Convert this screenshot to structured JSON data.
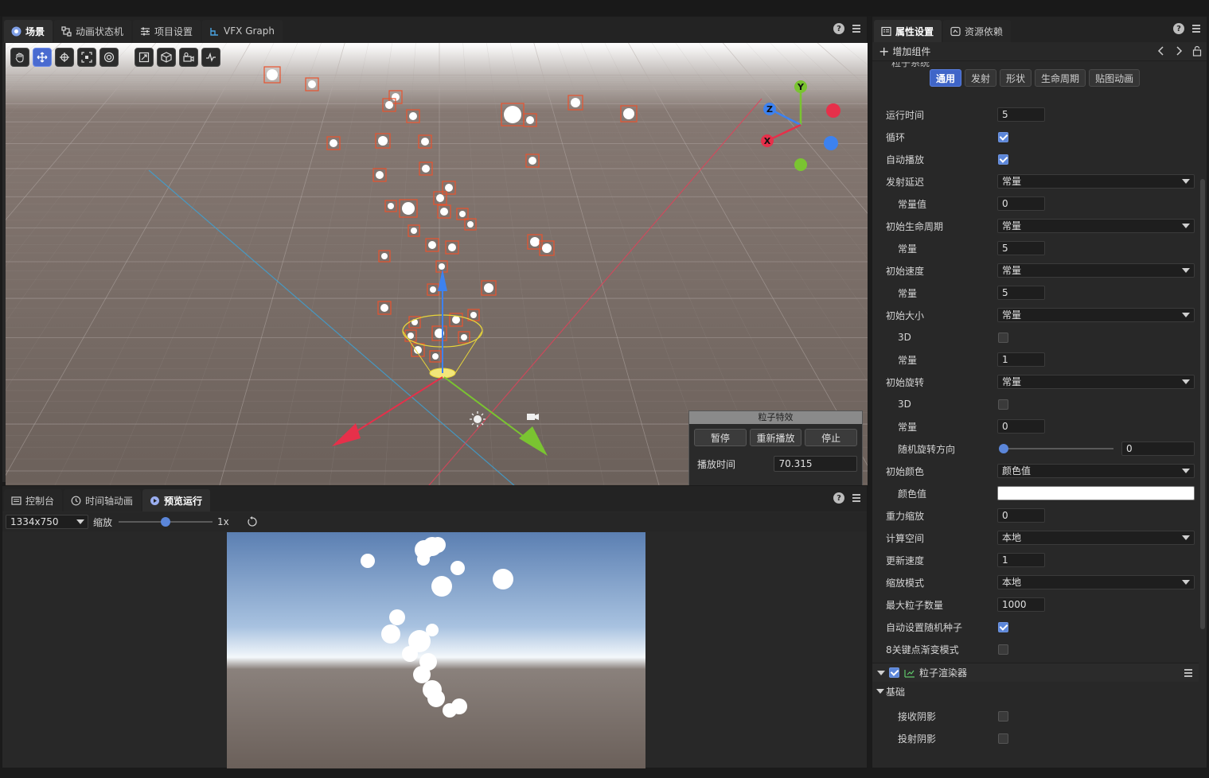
{
  "scene_panel": {
    "tabs": [
      {
        "label": "场景"
      },
      {
        "label": "动画状态机"
      },
      {
        "label": "项目设置"
      },
      {
        "label": "VFX Graph"
      }
    ],
    "help": "?"
  },
  "gizmo": {
    "x": "X",
    "y": "Y",
    "z": "Z"
  },
  "particle_fx": {
    "title": "粒子特效",
    "pause_label": "暂停",
    "replay_label": "重新播放",
    "stop_label": "停止",
    "play_time_label": "播放时间",
    "play_time_value": "70.315"
  },
  "bottom_panel": {
    "tabs": [
      {
        "label": "控制台"
      },
      {
        "label": "时间轴动画"
      },
      {
        "label": "预览运行"
      }
    ],
    "help": "?",
    "resolution": "1334x750",
    "zoom_label": "缩放",
    "zoom_value": "1x",
    "zoom_fraction": 0.5
  },
  "inspector": {
    "tabs": [
      {
        "label": "属性设置"
      },
      {
        "label": "资源依赖"
      }
    ],
    "help": "?",
    "add_component": "增加组件",
    "cut_label": "粒子系统",
    "subtabs": [
      "通用",
      "发射",
      "形状",
      "生命周期",
      "贴图动画"
    ],
    "props": {
      "duration": {
        "label": "运行时间",
        "value": "5"
      },
      "loop": {
        "label": "循环"
      },
      "auto_play": {
        "label": "自动播放"
      },
      "start_delay": {
        "label": "发射延迟",
        "mode": "常量"
      },
      "start_delay_const": {
        "label": "常量值",
        "value": "0"
      },
      "start_lifetime": {
        "label": "初始生命周期",
        "mode": "常量"
      },
      "start_lifetime_const": {
        "label": "常量",
        "value": "5"
      },
      "start_speed": {
        "label": "初始速度",
        "mode": "常量"
      },
      "start_speed_const": {
        "label": "常量",
        "value": "5"
      },
      "start_size": {
        "label": "初始大小",
        "mode": "常量"
      },
      "start_size_3d": {
        "label": "3D"
      },
      "start_size_const": {
        "label": "常量",
        "value": "1"
      },
      "start_rotation": {
        "label": "初始旋转",
        "mode": "常量"
      },
      "start_rotation_3d": {
        "label": "3D"
      },
      "start_rotation_const": {
        "label": "常量",
        "value": "0"
      },
      "random_rotation": {
        "label": "随机旋转方向",
        "value": "0"
      },
      "start_color": {
        "label": "初始颜色",
        "mode": "颜色值"
      },
      "start_color_value": {
        "label": "颜色值"
      },
      "gravity": {
        "label": "重力缩放",
        "value": "0"
      },
      "simulation_space": {
        "label": "计算空间",
        "mode": "本地"
      },
      "simulation_speed": {
        "label": "更新速度",
        "value": "1"
      },
      "scaling_mode": {
        "label": "缩放模式",
        "mode": "本地"
      },
      "max_particles": {
        "label": "最大粒子数量",
        "value": "1000"
      },
      "auto_random_seed": {
        "label": "自动设置随机种子"
      },
      "keyframe_gradient": {
        "label": "8关键点渐变模式"
      }
    },
    "renderer_section": "粒子渲染器",
    "basic_section": "基础",
    "receive_shadows": {
      "label": "接收阴影"
    },
    "cast_shadows": {
      "label": "投射阴影"
    }
  },
  "colors": {
    "accent": "#4a6bd0",
    "x_axis": "#e6304a",
    "y_axis": "#7ac431",
    "z_axis": "#3d82f0"
  }
}
